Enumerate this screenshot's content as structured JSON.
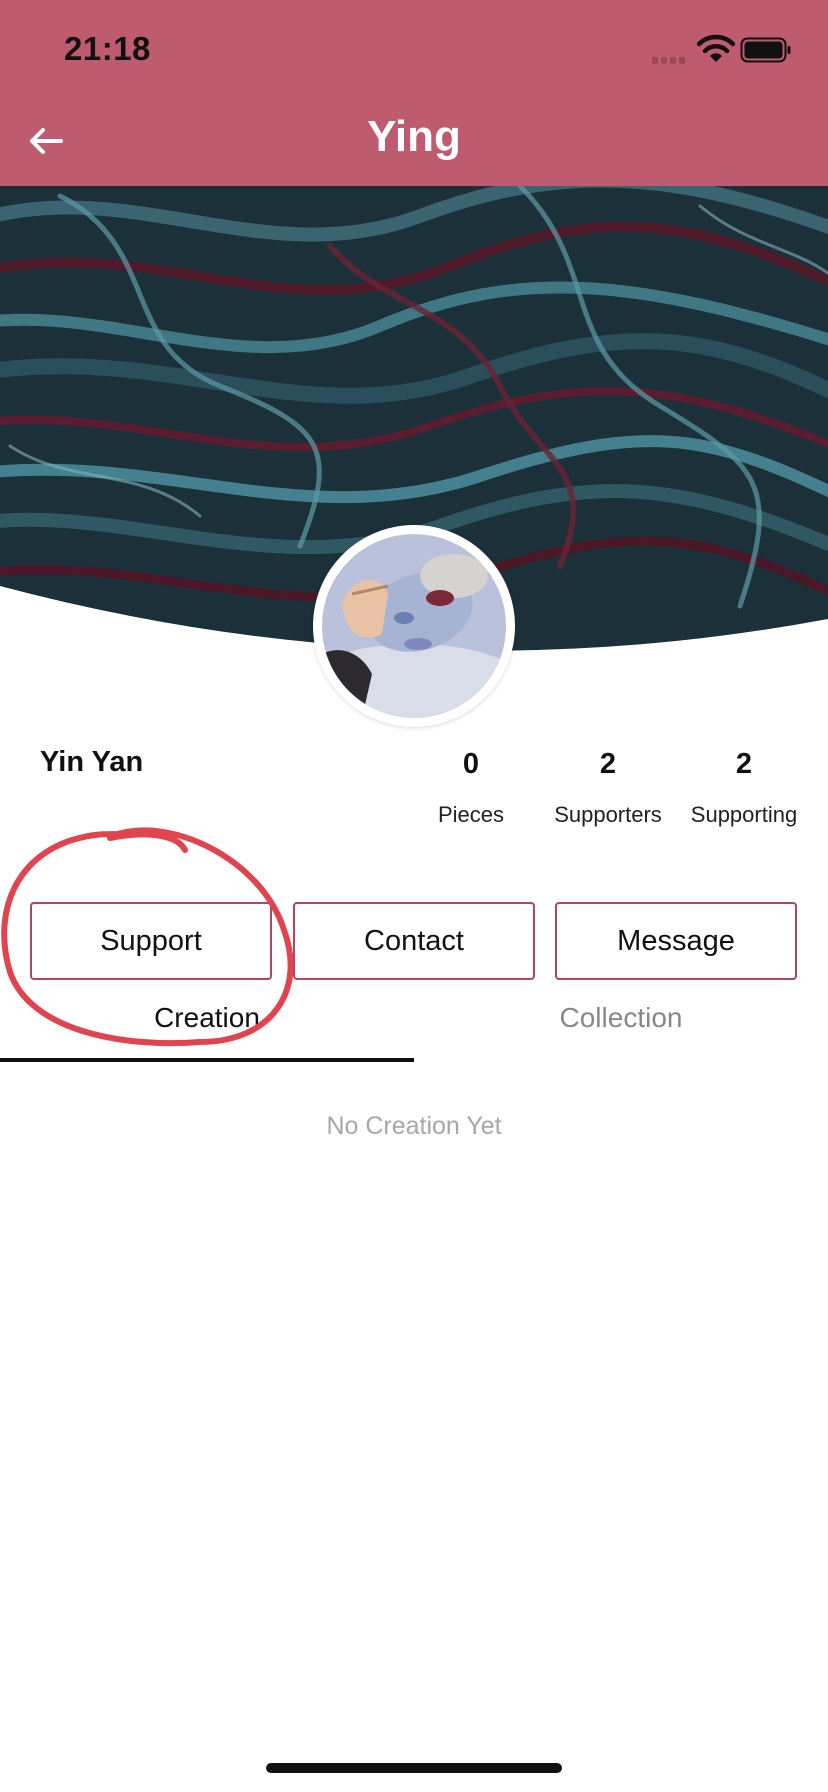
{
  "status_bar": {
    "time": "21:18"
  },
  "nav": {
    "title": "Ying",
    "back_icon": "arrow-left-icon"
  },
  "profile": {
    "name": "Yin Yan",
    "stats": [
      {
        "value": "0",
        "label": "Pieces"
      },
      {
        "value": "2",
        "label": "Supporters"
      },
      {
        "value": "2",
        "label": "Supporting"
      }
    ]
  },
  "actions": {
    "support": "Support",
    "contact": "Contact",
    "message": "Message"
  },
  "tabs": [
    {
      "label": "Creation",
      "active": true
    },
    {
      "label": "Collection",
      "active": false
    }
  ],
  "empty_state": "No Creation Yet",
  "colors": {
    "header": "#be5b6e",
    "button_border": "#b1475c",
    "annotation": "#e0444e",
    "inactive_tab": "#888888"
  }
}
